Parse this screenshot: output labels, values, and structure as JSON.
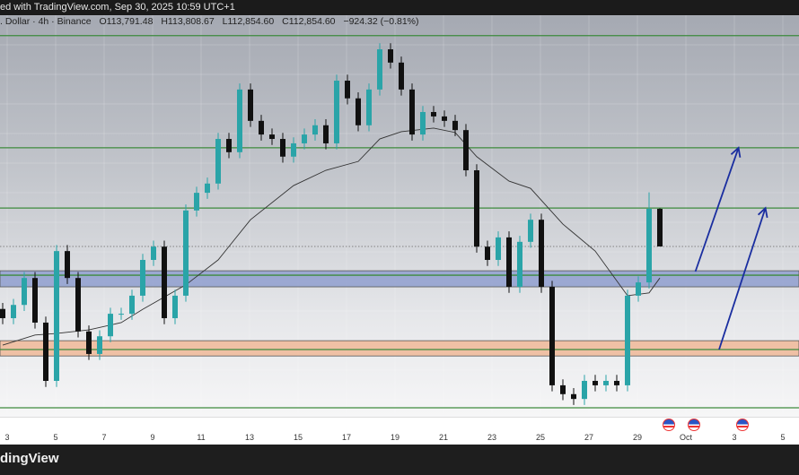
{
  "header": {
    "published": "ed with TradingView.com, Sep 30, 2025 10:59 UTC+1"
  },
  "legend": {
    "symbol": ". Dollar · 4h · Binance",
    "open": "O113,791.48",
    "high": "H113,808.67",
    "low": "L112,854.60",
    "close": "C112,854.60",
    "change": "−924.32 (−0.81%)"
  },
  "footer": {
    "logo": "dingView"
  },
  "colors": {
    "bull": "#2aa4a8",
    "bear": "#111111",
    "level": "#3d8a3d",
    "support_zone": "#8f9fcf",
    "demand_zone": "#f0b898",
    "arrow": "#1a2ea0",
    "ma": "#333333"
  },
  "chart_data": {
    "type": "candlestick",
    "timeframe": "4h",
    "x_ticks": [
      "3",
      "5",
      "7",
      "9",
      "11",
      "13",
      "15",
      "17",
      "19",
      "21",
      "23",
      "25",
      "27",
      "29",
      "Oct",
      "3",
      "5"
    ],
    "ylim": [
      108300,
      118900
    ],
    "open": [
      111300,
      111070,
      111400,
      112070,
      110960,
      109510,
      112740,
      112070,
      110740,
      110180,
      110620,
      111180,
      111180,
      111630,
      112520,
      112850,
      111070,
      111630,
      113750,
      114190,
      114420,
      115530,
      115200,
      116760,
      115980,
      115640,
      115530,
      115090,
      115420,
      115640,
      115870,
      115420,
      116980,
      116540,
      115870,
      116760,
      117760,
      117430,
      116760,
      115640,
      116200,
      116090,
      115980,
      115750,
      114750,
      112850,
      112520,
      113080,
      111850,
      112970,
      113520,
      111850,
      109400,
      109180,
      109060,
      109510,
      109400,
      109510,
      109400,
      111630,
      111960,
      113791.48
    ],
    "high": [
      111450,
      111550,
      112220,
      112220,
      111110,
      112890,
      112890,
      112220,
      110890,
      110770,
      111330,
      111330,
      111780,
      112670,
      113000,
      113000,
      111780,
      113900,
      114340,
      114570,
      115680,
      115680,
      116910,
      116910,
      116130,
      115790,
      115680,
      115570,
      115790,
      116020,
      116020,
      117130,
      117130,
      116690,
      116910,
      117910,
      117910,
      117580,
      116910,
      116350,
      116350,
      116240,
      116130,
      115900,
      114900,
      113000,
      113230,
      113230,
      113120,
      113670,
      113670,
      112000,
      109550,
      109330,
      109660,
      109660,
      109660,
      109660,
      111780,
      112110,
      114200,
      113808.67
    ],
    "low": [
      110920,
      110920,
      111250,
      110810,
      109360,
      109360,
      111920,
      110590,
      110030,
      110030,
      110470,
      111030,
      111030,
      111480,
      112370,
      110920,
      110920,
      111480,
      113600,
      114040,
      114270,
      115050,
      115050,
      115830,
      115490,
      115380,
      114940,
      114940,
      115270,
      115490,
      115270,
      115270,
      116390,
      115720,
      115720,
      116610,
      117280,
      116610,
      115490,
      115490,
      115940,
      115830,
      115600,
      114600,
      112700,
      112370,
      112370,
      111700,
      111700,
      112820,
      111700,
      109250,
      109030,
      108910,
      108910,
      109250,
      109250,
      109250,
      109250,
      111480,
      111810,
      112854.6
    ],
    "close": [
      111070,
      111400,
      112070,
      110960,
      109510,
      112740,
      112070,
      110740,
      110180,
      110620,
      111180,
      111180,
      111630,
      112520,
      112850,
      111070,
      111630,
      113750,
      114190,
      114420,
      115530,
      115200,
      116760,
      115980,
      115640,
      115530,
      115090,
      115420,
      115640,
      115870,
      115420,
      116980,
      116540,
      115870,
      116760,
      117760,
      117430,
      116760,
      115640,
      116200,
      116090,
      115980,
      115750,
      114750,
      112850,
      112520,
      113080,
      111850,
      112970,
      113520,
      111850,
      109400,
      109180,
      109060,
      109510,
      109400,
      109510,
      109400,
      111630,
      111960,
      113791.48,
      112854.6
    ],
    "moving_average": [
      [
        0,
        110400
      ],
      [
        3,
        110650
      ],
      [
        5,
        110690
      ],
      [
        8,
        110780
      ],
      [
        11,
        110960
      ],
      [
        13,
        111290
      ],
      [
        17,
        111900
      ],
      [
        20,
        112520
      ],
      [
        23,
        113520
      ],
      [
        27,
        114370
      ],
      [
        30,
        114750
      ],
      [
        33,
        114970
      ],
      [
        35,
        115530
      ],
      [
        37,
        115710
      ],
      [
        40,
        115800
      ],
      [
        42,
        115690
      ],
      [
        44,
        115090
      ],
      [
        47,
        114480
      ],
      [
        49,
        114300
      ],
      [
        52,
        113410
      ],
      [
        55,
        112740
      ],
      [
        58,
        111630
      ],
      [
        60,
        111700
      ],
      [
        61,
        112070
      ]
    ],
    "levels": [
      118100,
      115310,
      113810,
      112140,
      110290,
      108840
    ],
    "current_price": 112854.6,
    "zones": [
      {
        "name": "support",
        "from": 111850,
        "to": 112250
      },
      {
        "name": "demand",
        "from": 110130,
        "to": 110510
      }
    ],
    "arrows": [
      {
        "from": [
          64.3,
          112230
        ],
        "to": [
          68.3,
          115310
        ]
      },
      {
        "from": [
          66.5,
          110290
        ],
        "to": [
          70.8,
          113810
        ]
      }
    ],
    "events": [
      "us-flag",
      "us-flag",
      "us-flag"
    ]
  }
}
